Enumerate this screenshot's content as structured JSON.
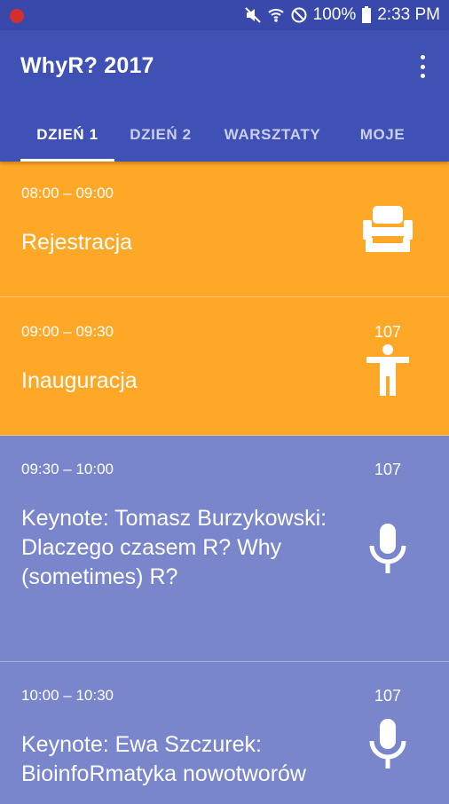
{
  "status_bar": {
    "battery": "100%",
    "time": "2:33 PM",
    "icons": [
      "record-dot-icon",
      "mute-icon",
      "wifi-icon",
      "block-icon",
      "battery-icon"
    ]
  },
  "app_bar": {
    "title": "WhyR? 2017",
    "menu_icon": "overflow-menu-icon"
  },
  "tabs": [
    {
      "label": "DZIEŃ 1",
      "active": true
    },
    {
      "label": "DZIEŃ 2",
      "active": false
    },
    {
      "label": "WARSZTATY",
      "active": false
    },
    {
      "label": "MOJE",
      "active": false
    }
  ],
  "colors": {
    "status_bar": "#3949ab",
    "app_bar": "#3f51b5",
    "orange_card": "#ffa726",
    "blue_card": "#7986cb"
  },
  "sessions": [
    {
      "time": "08:00 – 09:00",
      "title": "Rejestracja",
      "room": "",
      "icon": "seat-icon",
      "color": "#ffa726"
    },
    {
      "time": "09:00 – 09:30",
      "title": "Inauguracja",
      "room": "107",
      "icon": "person-icon",
      "color": "#ffa726"
    },
    {
      "time": "09:30 – 10:00",
      "title": "Keynote: Tomasz Burzykowski: Dlaczego czasem R? Why (sometimes) R?",
      "room": "107",
      "icon": "microphone-icon",
      "color": "#7986cb"
    },
    {
      "time": "10:00 – 10:30",
      "title": "Keynote: Ewa Szczurek: BioinfoRmatyka nowotworów",
      "room": "107",
      "icon": "microphone-icon",
      "color": "#7986cb"
    }
  ]
}
